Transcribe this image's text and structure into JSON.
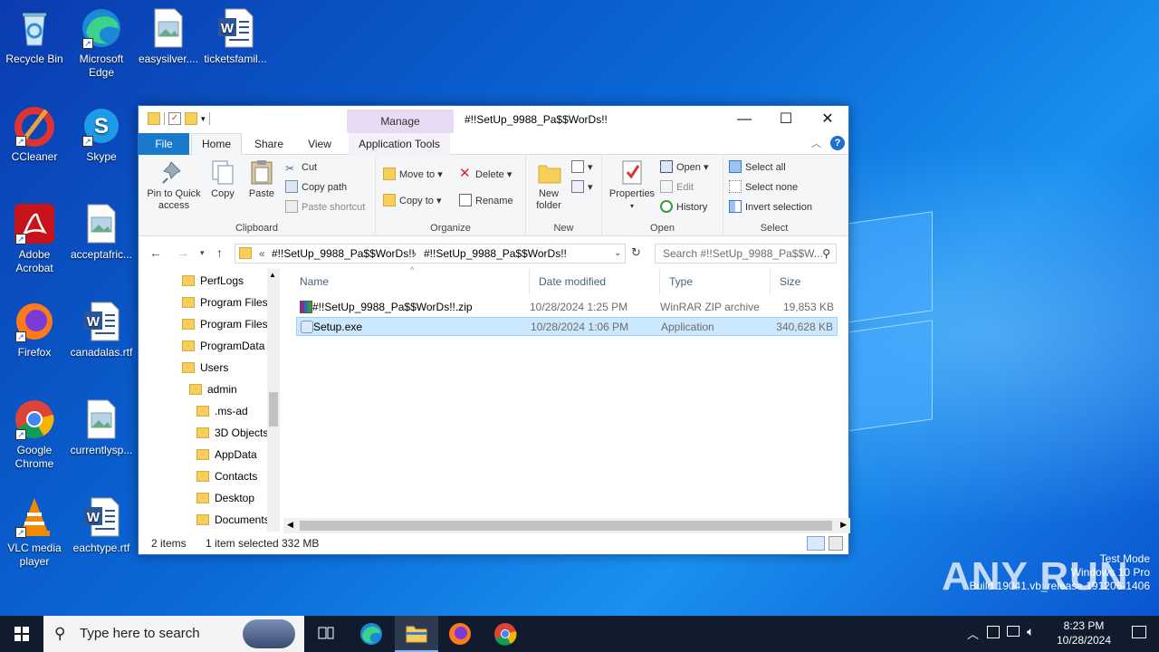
{
  "desktop": {
    "icons": [
      {
        "label": "Recycle Bin",
        "icon": "recycle-bin-icon"
      },
      {
        "label": "Microsoft Edge",
        "icon": "edge-icon"
      },
      {
        "label": "easysilver....",
        "icon": "image-file-icon"
      },
      {
        "label": "ticketsfamil...",
        "icon": "word-doc-icon"
      },
      {
        "label": "CCleaner",
        "icon": "ccleaner-icon"
      },
      {
        "label": "Skype",
        "icon": "skype-icon"
      },
      {
        "label": "Adobe Acrobat",
        "icon": "acrobat-icon"
      },
      {
        "label": "acceptafric...",
        "icon": "image-file-icon"
      },
      {
        "label": "Firefox",
        "icon": "firefox-icon"
      },
      {
        "label": "canadalas.rtf",
        "icon": "word-doc-icon"
      },
      {
        "label": "Google Chrome",
        "icon": "chrome-icon"
      },
      {
        "label": "currentlysp...",
        "icon": "image-file-icon"
      },
      {
        "label": "VLC media player",
        "icon": "vlc-icon"
      },
      {
        "label": "eachtype.rtf",
        "icon": "word-doc-icon"
      }
    ],
    "watermark": {
      "line1": "Test Mode",
      "line2": "Windows 10 Pro",
      "line3": "Build 19041.vb_release.191206-1406"
    },
    "brand": "ANY RUN"
  },
  "window": {
    "title": "#!!SetUp_9988_Pa$$WorDs!!",
    "manage_label": "Manage",
    "tabs": {
      "file": "File",
      "home": "Home",
      "share": "Share",
      "view": "View",
      "app_tools": "Application Tools"
    },
    "ribbon": {
      "clipboard": {
        "label": "Clipboard",
        "pin": "Pin to Quick access",
        "copy": "Copy",
        "paste": "Paste",
        "cut": "Cut",
        "copy_path": "Copy path",
        "paste_shortcut": "Paste shortcut"
      },
      "organize": {
        "label": "Organize",
        "move_to": "Move to",
        "copy_to": "Copy to",
        "delete": "Delete",
        "rename": "Rename"
      },
      "new": {
        "label": "New",
        "new_folder": "New folder"
      },
      "open": {
        "label": "Open",
        "properties": "Properties",
        "open": "Open",
        "edit": "Edit",
        "history": "History"
      },
      "select": {
        "label": "Select",
        "select_all": "Select all",
        "select_none": "Select none",
        "invert": "Invert selection"
      }
    },
    "address": {
      "prefix": "«",
      "crumb1": "#!!SetUp_9988_Pa$$WorDs!!",
      "sep": "›",
      "crumb2": "#!!SetUp_9988_Pa$$WorDs!!"
    },
    "search_placeholder": "Search #!!SetUp_9988_Pa$$W...",
    "nav": [
      {
        "label": "PerfLogs",
        "indent": 0
      },
      {
        "label": "Program Files",
        "indent": 0
      },
      {
        "label": "Program Files",
        "indent": 0
      },
      {
        "label": "ProgramData",
        "indent": 0
      },
      {
        "label": "Users",
        "indent": 0
      },
      {
        "label": "admin",
        "indent": 1
      },
      {
        "label": ".ms-ad",
        "indent": 2
      },
      {
        "label": "3D Objects",
        "indent": 2
      },
      {
        "label": "AppData",
        "indent": 2
      },
      {
        "label": "Contacts",
        "indent": 2
      },
      {
        "label": "Desktop",
        "indent": 2
      },
      {
        "label": "Documents",
        "indent": 2
      }
    ],
    "columns": {
      "name": "Name",
      "date": "Date modified",
      "type": "Type",
      "size": "Size"
    },
    "files": [
      {
        "name": "#!!SetUp_9988_Pa$$WorDs!!.zip",
        "date": "10/28/2024 1:25 PM",
        "type": "WinRAR ZIP archive",
        "size": "19,853 KB",
        "selected": false
      },
      {
        "name": "Setup.exe",
        "date": "10/28/2024 1:06 PM",
        "type": "Application",
        "size": "340,628 KB",
        "selected": true
      }
    ],
    "status": {
      "items": "2 items",
      "selected": "1 item selected",
      "size": "332 MB"
    }
  },
  "taskbar": {
    "search_placeholder": "Type here to search",
    "time": "8:23 PM",
    "date": "10/28/2024"
  }
}
